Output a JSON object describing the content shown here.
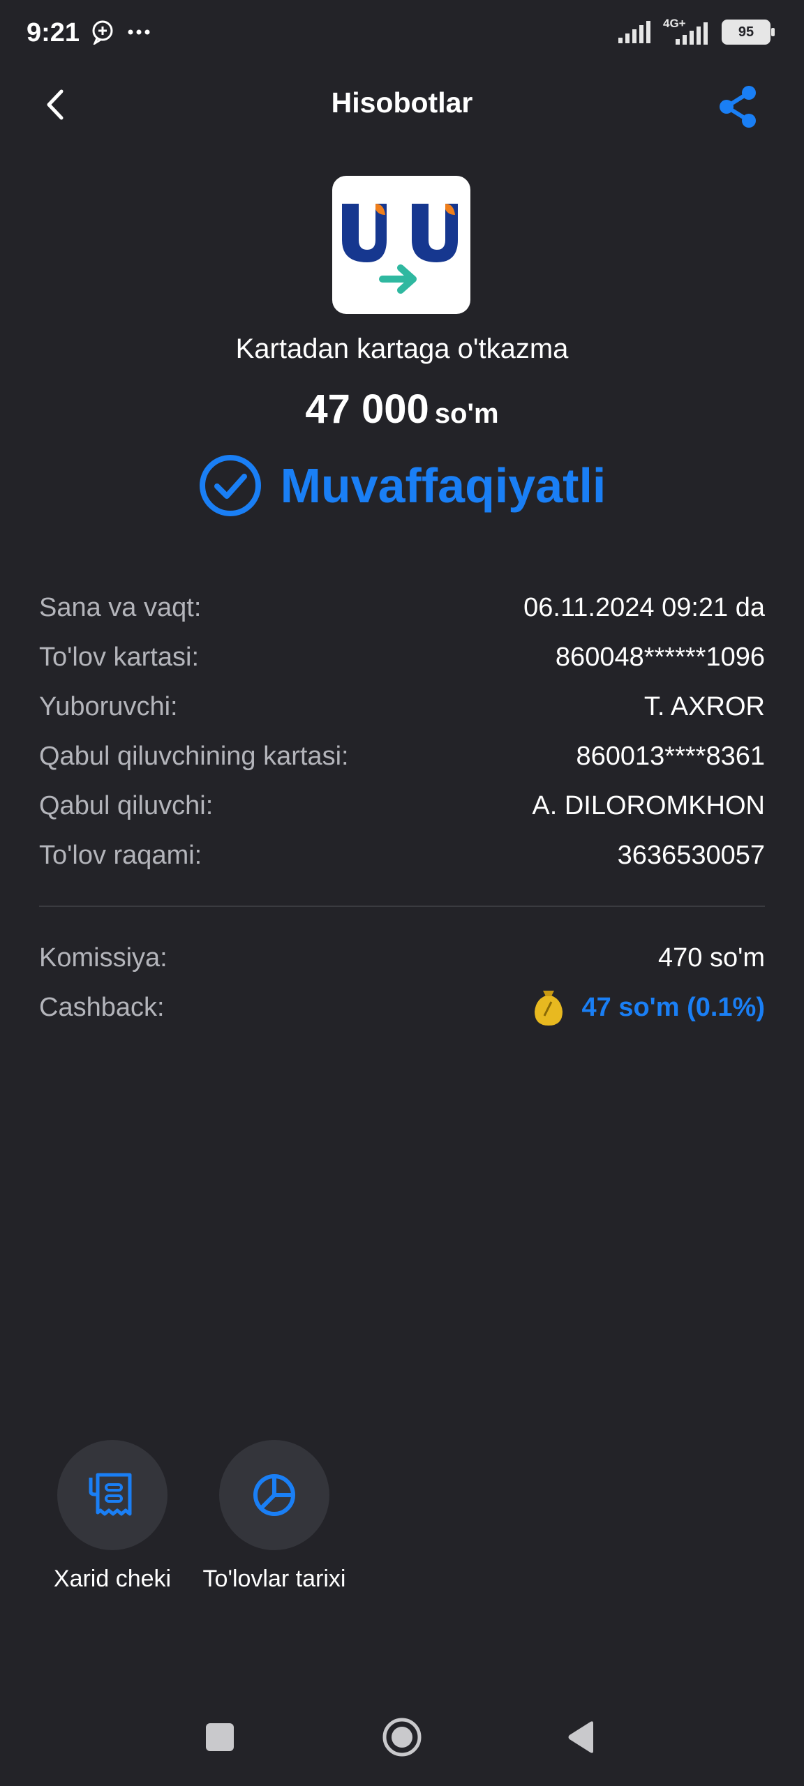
{
  "status_bar": {
    "time": "9:21",
    "network": "4G+",
    "battery": "95",
    "icons": [
      "chat-plus-icon",
      "more-dots-icon",
      "signal-icon",
      "signal-4g-icon",
      "battery-icon"
    ]
  },
  "header": {
    "title": "Hisobotlar",
    "back_icon": "chevron-left-icon",
    "share_icon": "share-icon"
  },
  "transaction": {
    "service_name": "Kartadan kartaga o'tkazma",
    "amount": "47 000",
    "currency": "so'm",
    "status": "Muvaffaqiyatli",
    "status_color": "#1a7ff5"
  },
  "details": [
    {
      "label": "Sana va vaqt:",
      "value": "06.11.2024 09:21 da"
    },
    {
      "label": "To'lov kartasi:",
      "value": "860048******1096"
    },
    {
      "label": "Yuboruvchi:",
      "value": "T. AXROR"
    },
    {
      "label": "Qabul qiluvchining kartasi:",
      "value": "860013****8361"
    },
    {
      "label": "Qabul qiluvchi:",
      "value": "A. DILOROMKHON"
    },
    {
      "label": "To'lov raqami:",
      "value": "3636530057"
    }
  ],
  "fees": {
    "commission_label": "Komissiya:",
    "commission_value": "470 so'm",
    "cashback_label": "Cashback:",
    "cashback_value": "47 so'm (0.1%)"
  },
  "actions": [
    {
      "label": "Xarid cheki",
      "icon": "receipt-icon"
    },
    {
      "label": "To'lovlar tarixi",
      "icon": "pie-chart-icon"
    }
  ],
  "nav": [
    "recent-apps-icon",
    "home-icon",
    "back-triangle-icon"
  ],
  "colors": {
    "background": "#232328",
    "accent": "#1a7ff5",
    "label": "#b4b5bb"
  }
}
